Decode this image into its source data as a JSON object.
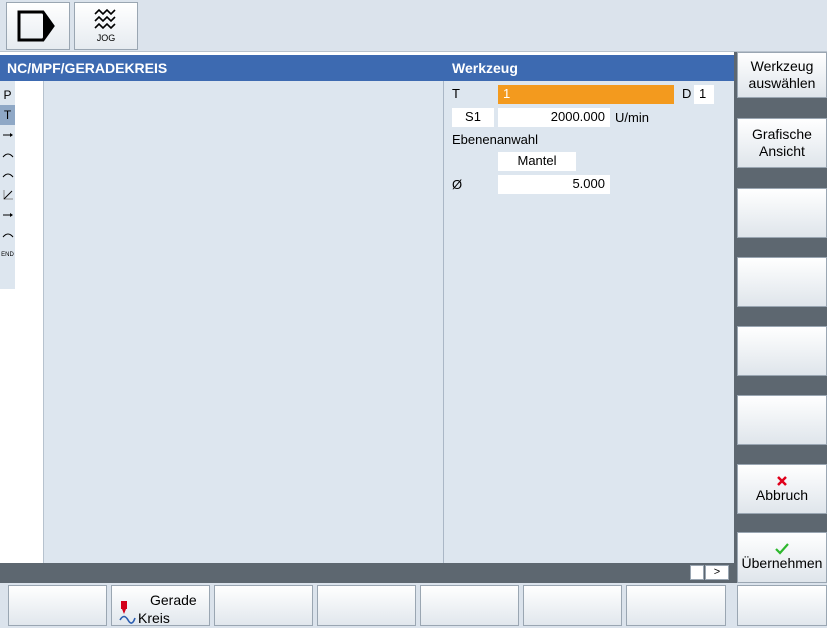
{
  "header": {
    "jog_label": "JOG"
  },
  "main": {
    "program_path": "NC/MPF/GERADEKREIS",
    "panel_title": "Werkzeug"
  },
  "steps": [
    {
      "label": "P",
      "icon": "program-header"
    },
    {
      "label": "T",
      "icon": "tool",
      "selected": true
    },
    {
      "label": "",
      "icon": "line-arrow-icon"
    },
    {
      "label": "",
      "icon": "arc-icon"
    },
    {
      "label": "",
      "icon": "arc-icon"
    },
    {
      "label": "",
      "icon": "diagonal-line-icon"
    },
    {
      "label": "",
      "icon": "line-arrow-icon"
    },
    {
      "label": "",
      "icon": "arc-icon"
    },
    {
      "label": "END",
      "icon": "end"
    }
  ],
  "params": {
    "t_label": "T",
    "t_value": "1",
    "d_label": "D",
    "d_value": "1",
    "spindle_label": "S1",
    "spindle_value": "2000.000",
    "spindle_unit": "U/min",
    "plane_label": "Ebenenanwahl",
    "plane_value": "Mantel",
    "diameter_symbol": "Ø",
    "diameter_value": "5.000"
  },
  "vertical_softkeys": [
    {
      "line1": "Werkzeug",
      "line2": "auswählen"
    },
    {
      "line1": "Grafische",
      "line2": "Ansicht"
    },
    {
      "line1": "",
      "line2": ""
    },
    {
      "line1": "",
      "line2": ""
    },
    {
      "line1": "",
      "line2": ""
    },
    {
      "line1": "",
      "line2": ""
    },
    {
      "line1": "Abbruch",
      "line2": "",
      "icon": "cancel-x-icon",
      "icon_color": "#e0001b"
    },
    {
      "line1": "Übernehmen",
      "line2": "",
      "icon": "check-icon",
      "icon_color": "#2eb82e"
    }
  ],
  "horizontal_softkeys": [
    {
      "line1": "",
      "line2": ""
    },
    {
      "line1": "Gerade",
      "line2": "Kreis",
      "icon": "line-circle-icon"
    },
    {
      "line1": "",
      "line2": ""
    },
    {
      "line1": "",
      "line2": ""
    },
    {
      "line1": "",
      "line2": ""
    },
    {
      "line1": "",
      "line2": ""
    },
    {
      "line1": "",
      "line2": ""
    }
  ],
  "status": {
    "next_page_symbol": ">"
  },
  "colors": {
    "header_blue": "#3d6ab1",
    "selected_field": "#f39a1e",
    "panel_bg": "#dde6ef",
    "softkey_bar": "#5d6770"
  }
}
